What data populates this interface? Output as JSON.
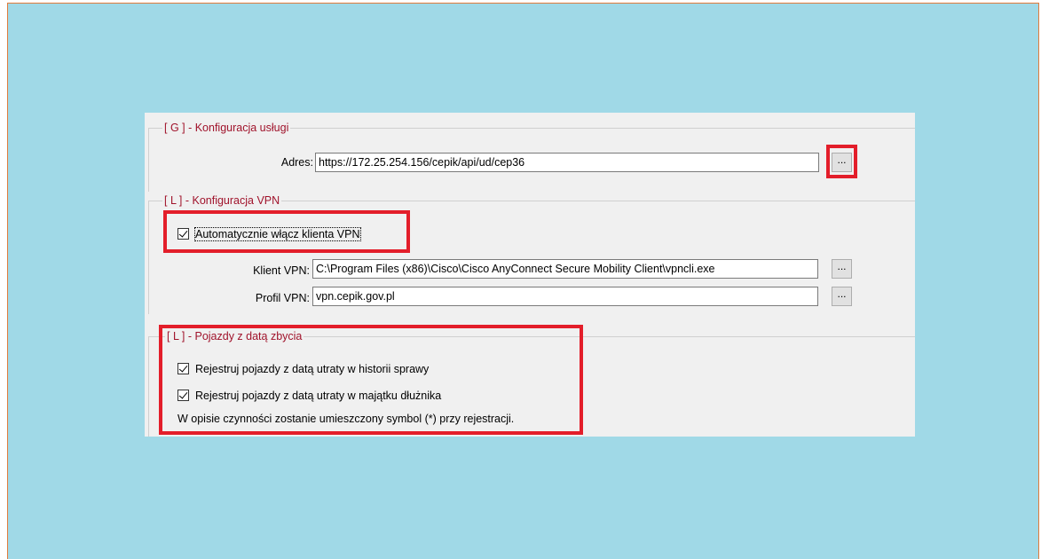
{
  "service_group": {
    "title": "[ G ] - Konfiguracja usługi",
    "address_label": "Adres:",
    "address_value": "https://172.25.254.156/cepik/api/ud/cep36",
    "browse_label": "..."
  },
  "vpn_group": {
    "title": "[ L ] - Konfiguracja VPN",
    "auto_vpn_label": "Automatycznie włącz klienta VPN",
    "auto_vpn_checked": true,
    "client_label": "Klient VPN:",
    "client_value": "C:\\Program Files (x86)\\Cisco\\Cisco AnyConnect Secure Mobility Client\\vpncli.exe",
    "client_browse_label": "...",
    "profile_label": "Profil VPN:",
    "profile_value": "vpn.cepik.gov.pl",
    "profile_browse_label": "..."
  },
  "vehicles_group": {
    "title": "[ L ] - Pojazdy z datą zbycia",
    "option_history_label": "Rejestruj pojazdy z datą utraty w historii sprawy",
    "option_history_checked": true,
    "option_assets_label": "Rejestruj pojazdy z datą utraty w majątku dłużnika",
    "option_assets_checked": true,
    "note": "W opisie czynności zostanie umieszczony symbol (*) przy rejestracji."
  },
  "colors": {
    "background": "#a0d9e7",
    "highlight": "#e31e2a",
    "group_title": "#a0132b"
  }
}
